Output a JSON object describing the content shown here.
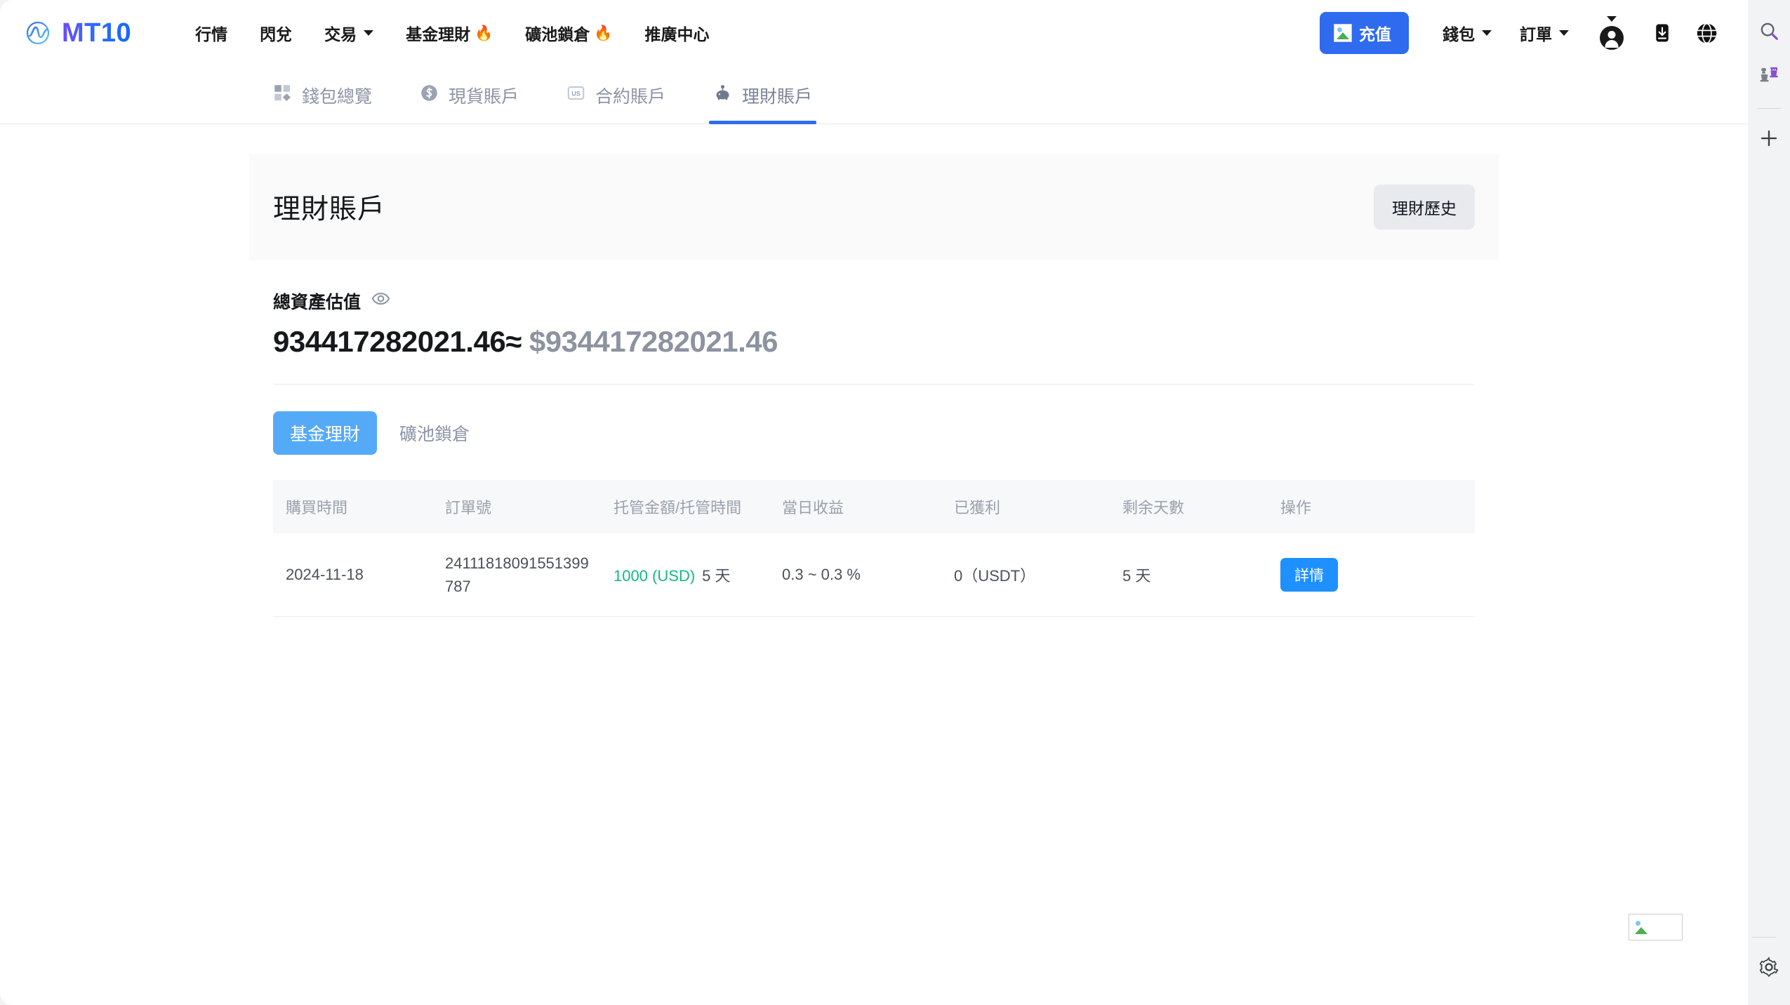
{
  "brand": {
    "name": "MT10",
    "logo_icon": "wave-circle-icon"
  },
  "topnav": {
    "items": [
      {
        "label": "行情",
        "icon": null,
        "caret": false
      },
      {
        "label": "閃兌",
        "icon": null,
        "caret": false
      },
      {
        "label": "交易",
        "icon": null,
        "caret": true
      },
      {
        "label": "基金理財",
        "icon": "fire-emoji",
        "caret": false
      },
      {
        "label": "礦池鎖倉",
        "icon": "fire-emoji",
        "caret": false
      },
      {
        "label": "推廣中心",
        "icon": null,
        "caret": false
      }
    ],
    "deposit_label": "充值",
    "deposit_icon": "broken-image-icon",
    "wallet_label": "錢包",
    "orders_label": "訂單",
    "download_icon": "download-icon",
    "language_icon": "globe-icon",
    "avatar_icon": "user-avatar-icon"
  },
  "account_tabs": [
    {
      "label": "錢包總覽",
      "icon": "grid-icon",
      "active": false
    },
    {
      "label": "現貨賬戶",
      "icon": "dollar-coin-icon",
      "active": false
    },
    {
      "label": "合約賬戶",
      "icon": "us-badge-icon",
      "active": false
    },
    {
      "label": "理財賬戶",
      "icon": "piggy-bank-icon",
      "active": true
    }
  ],
  "page": {
    "title": "理財賬戶",
    "history_button": "理財歷史",
    "totals": {
      "label": "總資產估值",
      "eye_icon": "eye-icon",
      "value": "934417282021.46",
      "approx_symbol": "≈",
      "currency_symbol": "$",
      "usd_value": "934417282021.46"
    },
    "subtabs": [
      {
        "label": "基金理財",
        "active": true
      },
      {
        "label": "礦池鎖倉",
        "active": false
      }
    ],
    "table": {
      "columns": [
        "購買時間",
        "訂單號",
        "托管金額/托管時間",
        "當日收益",
        "已獲利",
        "剩余天數",
        "操作"
      ],
      "rows": [
        {
          "purchase_time": "2024-11-18",
          "order_no": "24111818091551399787",
          "amount": "1000 (USD)",
          "duration": "5 天",
          "daily_yield": "0.3 ~ 0.3 %",
          "profit": "0（USDT）",
          "days_left": "5 天",
          "action_label": "詳情"
        }
      ]
    }
  },
  "browser_rail": {
    "search_icon": "search-icon",
    "extension_icon": "chess-pieces-icon",
    "add_icon": "plus-icon",
    "settings_icon": "gear-icon"
  },
  "colors": {
    "brand_blue": "#2f6bef",
    "accent_blue": "#1e90ff",
    "subtab_blue": "#55aaf7",
    "green": "#12b981",
    "muted": "#8a94a6"
  }
}
